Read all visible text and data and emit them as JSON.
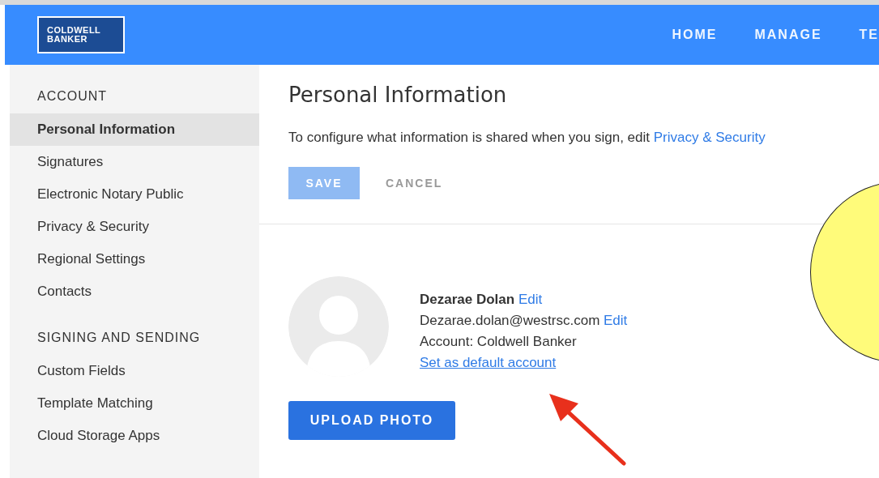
{
  "header": {
    "logo": [
      "COLDWELL",
      "BANKER"
    ],
    "nav": [
      {
        "label": "HOME",
        "selected": false
      },
      {
        "label": "MANAGE",
        "selected": false
      },
      {
        "label": "TE",
        "selected": false
      }
    ]
  },
  "sidebar": {
    "sections": [
      {
        "heading": "ACCOUNT",
        "items": [
          {
            "label": "Personal Information",
            "selected": true
          },
          {
            "label": "Signatures",
            "selected": false
          },
          {
            "label": "Electronic Notary Public",
            "selected": false
          },
          {
            "label": "Privacy & Security",
            "selected": false
          },
          {
            "label": "Regional Settings",
            "selected": false
          },
          {
            "label": "Contacts",
            "selected": false
          }
        ]
      },
      {
        "heading": "SIGNING AND SENDING",
        "items": [
          {
            "label": "Custom Fields",
            "selected": false
          },
          {
            "label": "Template Matching",
            "selected": false
          },
          {
            "label": "Cloud Storage Apps",
            "selected": false
          }
        ]
      }
    ]
  },
  "main": {
    "title": "Personal Information",
    "intro": "To configure what information is shared when you sign, edit",
    "intro_link": "Privacy & Security",
    "save": {
      "label": "SAVE",
      "disabled": true
    },
    "cancel": "CANCEL",
    "profile": {
      "name": "Dezarae Dolan",
      "name_edit": "Edit",
      "email": "Dezarae.dolan@westrsc.com",
      "email_edit": "Edit",
      "account": "Account: Coldwell Banker",
      "default_link": "Set as default account"
    },
    "upload": "UPLOAD PHOTO"
  }
}
